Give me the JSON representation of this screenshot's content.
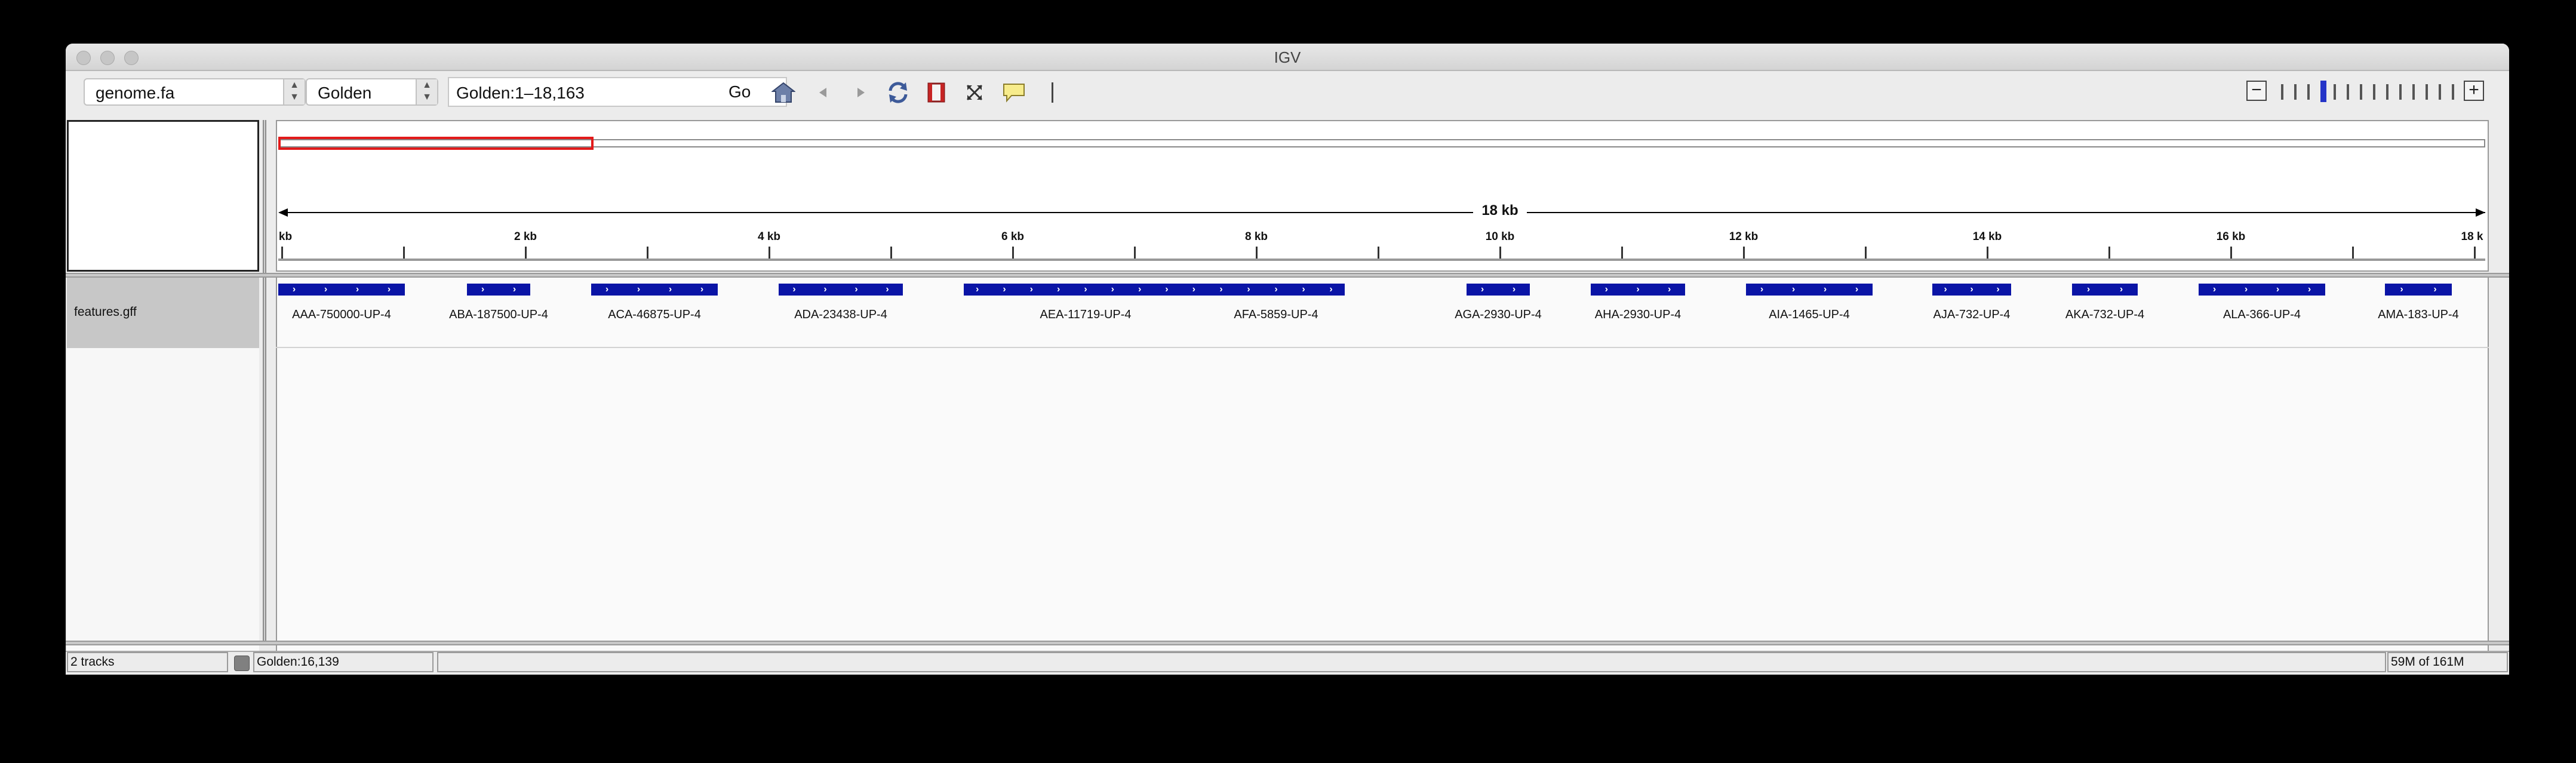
{
  "window": {
    "title": "IGV"
  },
  "toolbar": {
    "genome_value": "genome.fa",
    "chromosome_value": "Golden",
    "locus_value": "Golden:1–18,163",
    "go_label": "Go",
    "icons": [
      "home-icon",
      "back-arrow-icon",
      "forward-arrow-icon",
      "refresh-icon",
      "region-of-interest-icon",
      "resize-to-window-icon",
      "popup-text-icon",
      "vertical-line-icon"
    ],
    "zoom": {
      "minus_label": "−",
      "plus_label": "+",
      "levels": 14,
      "current_level": 3
    }
  },
  "ruler": {
    "span_label": "18 kb",
    "tick_labels": [
      "kb",
      "2 kb",
      "4 kb",
      "6 kb",
      "8 kb",
      "10 kb",
      "12 kb",
      "14 kb",
      "16 kb",
      "18 k"
    ]
  },
  "tracks": {
    "features": {
      "name": "features.gff",
      "items": [
        {
          "label": "AAA-750000-UP-4"
        },
        {
          "label": "ABA-187500-UP-4"
        },
        {
          "label": "ACA-46875-UP-4"
        },
        {
          "label": "ADA-23438-UP-4"
        },
        {
          "label": "AEA-11719-UP-4"
        },
        {
          "label": "AFA-5859-UP-4"
        },
        {
          "label": "AGA-2930-UP-4"
        },
        {
          "label": "AHA-2930-UP-4"
        },
        {
          "label": "AIA-1465-UP-4"
        },
        {
          "label": "AJA-732-UP-4"
        },
        {
          "label": "AKA-732-UP-4"
        },
        {
          "label": "ALA-366-UP-4"
        },
        {
          "label": "AMA-183-UP-4"
        }
      ]
    }
  },
  "status": {
    "tracks": "2 tracks",
    "position": "Golden:16,139",
    "message": "",
    "memory": "59M of 161M"
  },
  "colors": {
    "feature": "#0a14a6",
    "region_box": "#e21a1a",
    "zoom_current": "#2434c8"
  }
}
